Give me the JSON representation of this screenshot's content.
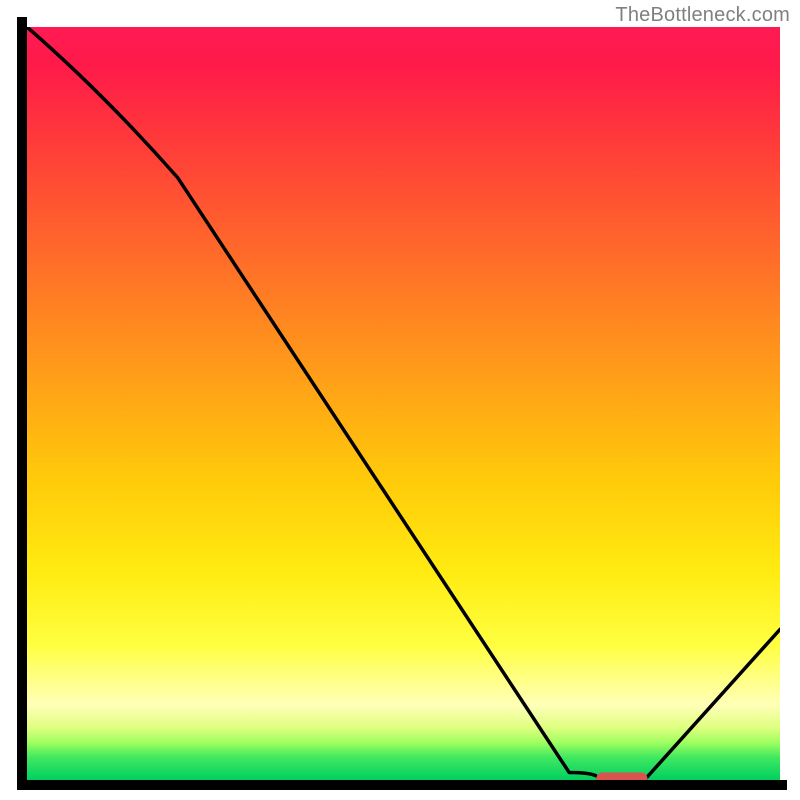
{
  "watermark": "TheBottleneck.com",
  "chart_data": {
    "type": "line",
    "title": "",
    "xlabel": "",
    "ylabel": "",
    "xlim": [
      0,
      100
    ],
    "ylim": [
      0,
      100
    ],
    "grid": false,
    "legend": false,
    "series": [
      {
        "name": "bottleneck-curve",
        "x": [
          0,
          20,
          72,
          76,
          82,
          100
        ],
        "values": [
          100,
          80,
          1,
          0,
          0,
          20
        ]
      }
    ],
    "marker": {
      "name": "optimal-zone",
      "x_start": 76,
      "x_end": 82,
      "y": 0
    },
    "background": {
      "type": "vertical-gradient",
      "stops": [
        {
          "pos": 0,
          "color": "#ff1a54"
        },
        {
          "pos": 15,
          "color": "#ff3a3a"
        },
        {
          "pos": 45,
          "color": "#ff9a1a"
        },
        {
          "pos": 72,
          "color": "#ffea10"
        },
        {
          "pos": 90,
          "color": "#ffffb8"
        },
        {
          "pos": 100,
          "color": "#00d060"
        }
      ]
    }
  }
}
